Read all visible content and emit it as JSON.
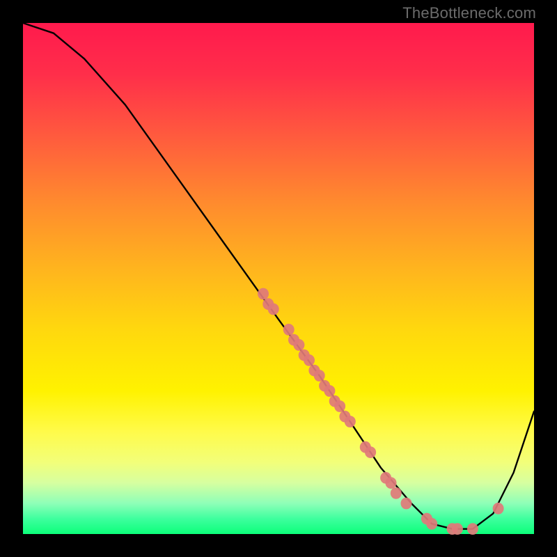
{
  "watermark": "TheBottleneck.com",
  "chart_data": {
    "type": "line",
    "title": "",
    "xlabel": "",
    "ylabel": "",
    "xlim": [
      0,
      100
    ],
    "ylim": [
      0,
      100
    ],
    "grid": false,
    "legend": false,
    "gradient_stops": [
      {
        "pos": 0,
        "color": "#ff1a4d"
      },
      {
        "pos": 10,
        "color": "#ff2e4a"
      },
      {
        "pos": 22,
        "color": "#ff5a3e"
      },
      {
        "pos": 35,
        "color": "#ff8a2e"
      },
      {
        "pos": 48,
        "color": "#ffb41e"
      },
      {
        "pos": 60,
        "color": "#ffd80e"
      },
      {
        "pos": 72,
        "color": "#fff200"
      },
      {
        "pos": 80,
        "color": "#fffb4a"
      },
      {
        "pos": 86,
        "color": "#f2ff7a"
      },
      {
        "pos": 90,
        "color": "#d6ffa0"
      },
      {
        "pos": 94,
        "color": "#8effb8"
      },
      {
        "pos": 97,
        "color": "#3eff9e"
      },
      {
        "pos": 100,
        "color": "#0cff7a"
      }
    ],
    "series": [
      {
        "name": "curve",
        "stroke": "#000000",
        "x": [
          0,
          6,
          12,
          20,
          30,
          40,
          50,
          58,
          64,
          70,
          76,
          80,
          84,
          88,
          92,
          96,
          100
        ],
        "y": [
          100,
          98,
          93,
          84,
          70,
          56,
          42,
          31,
          22,
          13,
          6,
          2,
          1,
          1,
          4,
          12,
          24
        ]
      }
    ],
    "markers": {
      "name": "datapoints",
      "color": "#e07a7a",
      "radius_px": 8,
      "points": [
        {
          "x": 47,
          "y": 47
        },
        {
          "x": 48,
          "y": 45
        },
        {
          "x": 49,
          "y": 44
        },
        {
          "x": 52,
          "y": 40
        },
        {
          "x": 53,
          "y": 38
        },
        {
          "x": 54,
          "y": 37
        },
        {
          "x": 55,
          "y": 35
        },
        {
          "x": 56,
          "y": 34
        },
        {
          "x": 57,
          "y": 32
        },
        {
          "x": 58,
          "y": 31
        },
        {
          "x": 59,
          "y": 29
        },
        {
          "x": 60,
          "y": 28
        },
        {
          "x": 61,
          "y": 26
        },
        {
          "x": 62,
          "y": 25
        },
        {
          "x": 63,
          "y": 23
        },
        {
          "x": 64,
          "y": 22
        },
        {
          "x": 67,
          "y": 17
        },
        {
          "x": 68,
          "y": 16
        },
        {
          "x": 71,
          "y": 11
        },
        {
          "x": 72,
          "y": 10
        },
        {
          "x": 73,
          "y": 8
        },
        {
          "x": 75,
          "y": 6
        },
        {
          "x": 79,
          "y": 3
        },
        {
          "x": 80,
          "y": 2
        },
        {
          "x": 84,
          "y": 1
        },
        {
          "x": 85,
          "y": 1
        },
        {
          "x": 88,
          "y": 1
        },
        {
          "x": 93,
          "y": 5
        }
      ]
    }
  }
}
